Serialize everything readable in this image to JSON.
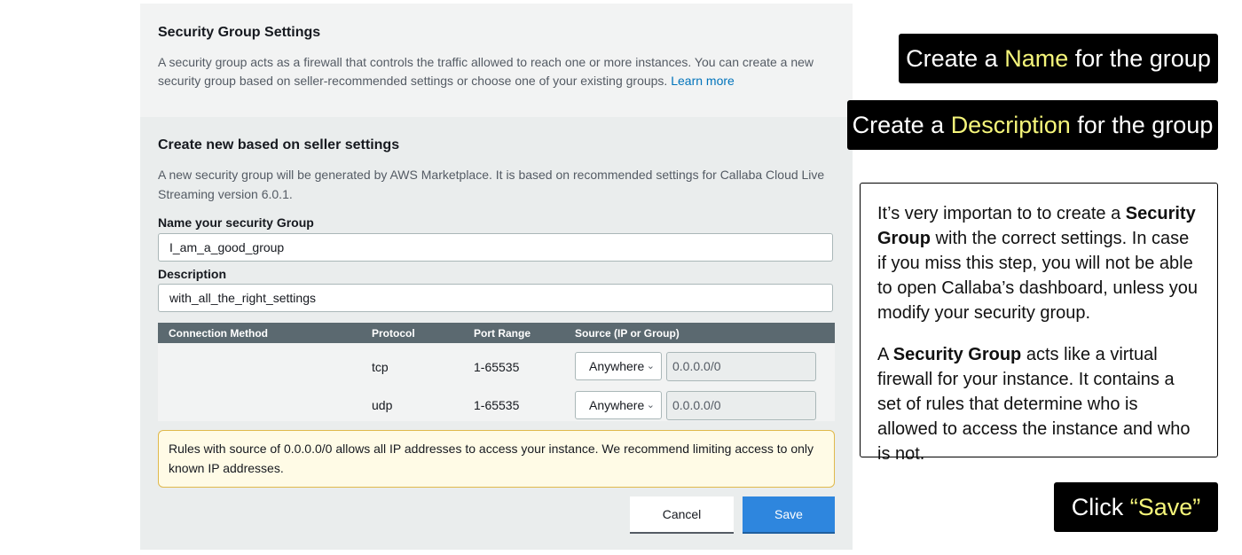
{
  "settings": {
    "title": "Security Group Settings",
    "description": "A security group acts as a firewall that controls the traffic allowed to reach one or more instances. You can create a new security group based on seller-recommended settings or choose one of your existing groups.",
    "learn_more": "Learn more"
  },
  "create_new": {
    "title": "Create new based on seller settings",
    "description": "A new security group will be generated by AWS Marketplace. It is based on recommended settings for Callaba Cloud Live Streaming version 6.0.1.",
    "name_label": "Name your security Group",
    "name_value": "I_am_a_good_group",
    "description_label": "Description",
    "description_value": "with_all_the_right_settings"
  },
  "rules_table": {
    "headers": [
      "Connection Method",
      "Protocol",
      "Port Range",
      "Source (IP or Group)"
    ],
    "rows": [
      {
        "protocol": "tcp",
        "port_range": "1-65535",
        "source_select": "Anywhere",
        "source_ip": "0.0.0.0/0"
      },
      {
        "protocol": "udp",
        "port_range": "1-65535",
        "source_select": "Anywhere",
        "source_ip": "0.0.0.0/0"
      }
    ]
  },
  "warning": "Rules with source of 0.0.0.0/0 allows all IP addresses to access your instance. We recommend limiting access to only known IP addresses.",
  "buttons": {
    "cancel": "Cancel",
    "save": "Save"
  },
  "annotations": {
    "name_callout": {
      "pre": "Create a ",
      "highlight": "Name",
      "post": " for the group"
    },
    "description_callout": {
      "pre": "Create a ",
      "highlight": "Description",
      "post": " for the group"
    },
    "info_p1": {
      "a": "It’s very importan to to create a ",
      "b": "Security Group",
      "c": " with the correct settings. In case if you miss this step, you will not be able to open Callaba’s dashboard, unless you modify your security group."
    },
    "info_p2": {
      "a": "A ",
      "b": "Security Group",
      "c": " acts like a virtual firewall for your instance. It contains a set of rules that determine who is allowed to access the instance and who is not."
    },
    "save_callout": {
      "pre": "Click ",
      "highlight": "“Save”"
    }
  },
  "colors": {
    "highlight": "#f5f57a",
    "primary_button": "#2e86de",
    "link": "#0073bb"
  }
}
